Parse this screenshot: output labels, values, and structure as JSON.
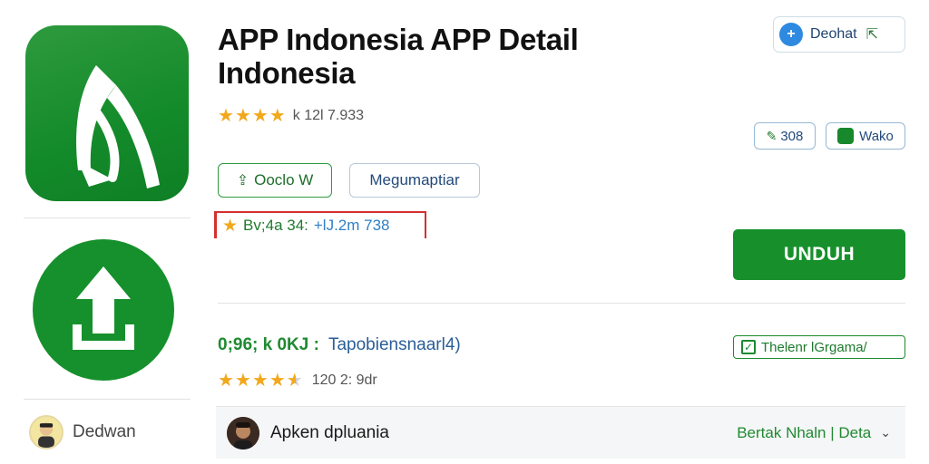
{
  "app": {
    "title": "APP Indonesia APP Detail Indonesia",
    "rating_text": "k 12l 7.933",
    "rating_stars": 4
  },
  "buttons": {
    "primary_outline": "Ooclo W",
    "secondary_outline": "Megumaptiar",
    "top_chip": "Deohat",
    "chip_a": "308",
    "chip_b": "Wako",
    "download": "UNDUH",
    "badge": "Thelenr lGrgama/"
  },
  "meta": {
    "left": "Bv;4a 34:",
    "right": "+lJ.2m 738"
  },
  "stats": {
    "green": "0;96; k 0KJ :",
    "blue": "Tapobiensnaarl4)",
    "rating_text": "120 2: 9dr",
    "rating_stars": 4.5
  },
  "developer": {
    "sidebar_name": "Dedwan",
    "panel_name": "Apken dpluania",
    "panel_link": "Bertak Nhaln | Deta"
  },
  "colors": {
    "brand_green": "#17902c",
    "star": "#f2a81c",
    "link_blue": "#2a5e98",
    "highlight_red": "#d43030"
  },
  "icons": [
    "app-logo-icon",
    "download-arrow-icon",
    "star-icon",
    "share-icon",
    "info-icon",
    "checkbox-icon",
    "chevron-down-icon"
  ]
}
